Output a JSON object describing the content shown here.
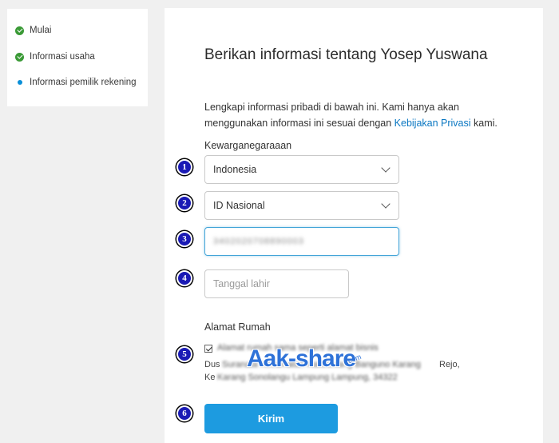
{
  "sidebar": {
    "steps": [
      {
        "label": "Mulai",
        "state": "done"
      },
      {
        "label": "Informasi usaha",
        "state": "done"
      },
      {
        "label": "Informasi pemilik rekening",
        "state": "current"
      }
    ]
  },
  "form": {
    "title": "Berikan informasi tentang Yosep Yuswana",
    "desc_part1": "Lengkapi informasi pribadi di bawah ini. Kami hanya akan menggunakan informasi ini sesuai dengan ",
    "desc_link": "Kebijakan Privasi",
    "desc_part2": " kami.",
    "citizenship_label": "Kewarganegaraaan",
    "country_value": "Indonesia",
    "id_type_value": "ID Nasional",
    "id_number_value": "3402020708890003",
    "dob_placeholder": "Tanggal lahir",
    "address_label": "Alamat Rumah",
    "address_checkbox_text": "Alamat rumah sama seperti alamat bisnis",
    "address_line1_start": "Dus",
    "address_line1_end": "Rejo,",
    "address_line2_start": "Ke",
    "submit_label": "Kirim"
  },
  "badges": [
    "1",
    "2",
    "3",
    "4",
    "5",
    "6"
  ],
  "watermark": {
    "text": "Aak-share",
    "suffix": ".com"
  },
  "colors": {
    "accent": "#1d9be0",
    "done": "#3a9a36",
    "link": "#0a77c2",
    "badge": "#1a1ab5"
  }
}
